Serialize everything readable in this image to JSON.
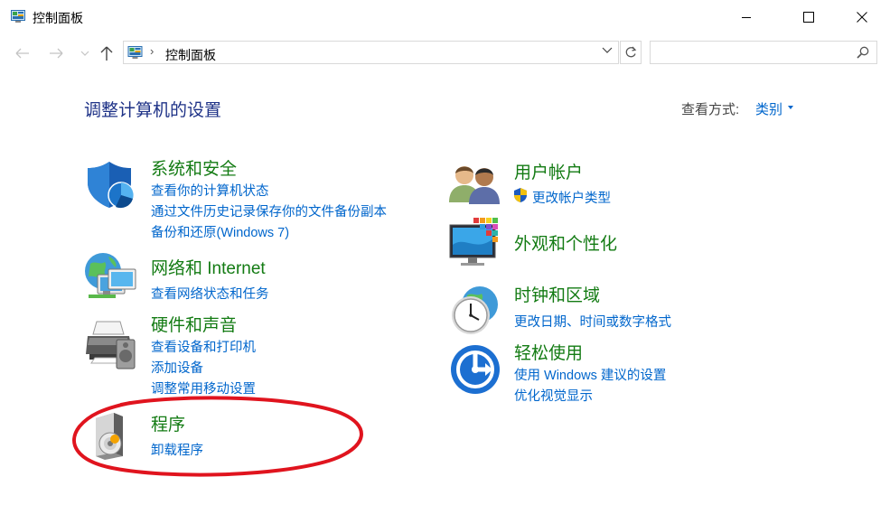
{
  "window": {
    "title": "控制面板"
  },
  "nav": {
    "address_path": "控制面板",
    "separator": "›",
    "search_placeholder": ""
  },
  "content": {
    "heading": "调整计算机的设置",
    "view_by_label": "查看方式:",
    "view_by_value": "类别"
  },
  "categories": [
    {
      "title": "系统和安全",
      "icon": "shield-icon",
      "links": [
        "查看你的计算机状态",
        "通过文件历史记录保存你的文件备份副本",
        "备份和还原(Windows 7)"
      ]
    },
    {
      "title": "网络和 Internet",
      "icon": "network-icon",
      "links": [
        "查看网络状态和任务"
      ]
    },
    {
      "title": "硬件和声音",
      "icon": "printer-icon",
      "links": [
        "查看设备和打印机",
        "添加设备",
        "调整常用移动设置"
      ]
    },
    {
      "title": "程序",
      "icon": "programs-icon",
      "links": [
        "卸载程序"
      ]
    },
    {
      "title": "用户帐户",
      "icon": "users-icon",
      "links": [
        "更改帐户类型"
      ]
    },
    {
      "title": "外观和个性化",
      "icon": "monitor-icon",
      "links": []
    },
    {
      "title": "时钟和区域",
      "icon": "clock-icon",
      "links": [
        "更改日期、时间或数字格式"
      ]
    },
    {
      "title": "轻松使用",
      "icon": "ease-of-access-icon",
      "links": [
        "使用 Windows 建议的设置",
        "优化视觉显示"
      ]
    }
  ],
  "colors": {
    "category_title": "#137b13",
    "link": "#0066cc",
    "heading": "#1e3287",
    "annotation": "#e0141e"
  }
}
